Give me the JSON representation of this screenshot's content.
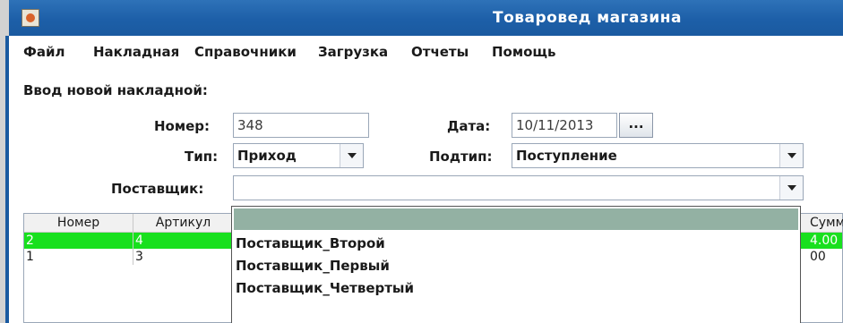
{
  "window": {
    "title": "Товаровед магазина",
    "icon": "java-cup-icon"
  },
  "menu": [
    "Файл",
    "Накладная",
    "Справочники",
    "Загрузка",
    "Отчеты",
    "Помощь"
  ],
  "form": {
    "heading": "Ввод новой накладной:",
    "number_label": "Номер:",
    "number_value": "348",
    "date_label": "Дата:",
    "date_value": "10/11/2013",
    "date_button": "...",
    "type_label": "Тип:",
    "type_value": "Приход",
    "subtype_label": "Подтип:",
    "subtype_value": "Поступление",
    "supplier_label": "Поставщик:",
    "supplier_value": ""
  },
  "table": {
    "columns": [
      "Номер",
      "Артикул",
      "Сумма"
    ],
    "rows": [
      {
        "number": "2",
        "article": "4",
        "sum": "4.00",
        "selected": true
      },
      {
        "number": "1",
        "article": "3",
        "sum": "00",
        "selected": false
      }
    ]
  },
  "dropdown": {
    "options": [
      "",
      "Поставщик_Второй",
      "Поставщик_Первый",
      "Поставщик_Четвертый"
    ]
  }
}
